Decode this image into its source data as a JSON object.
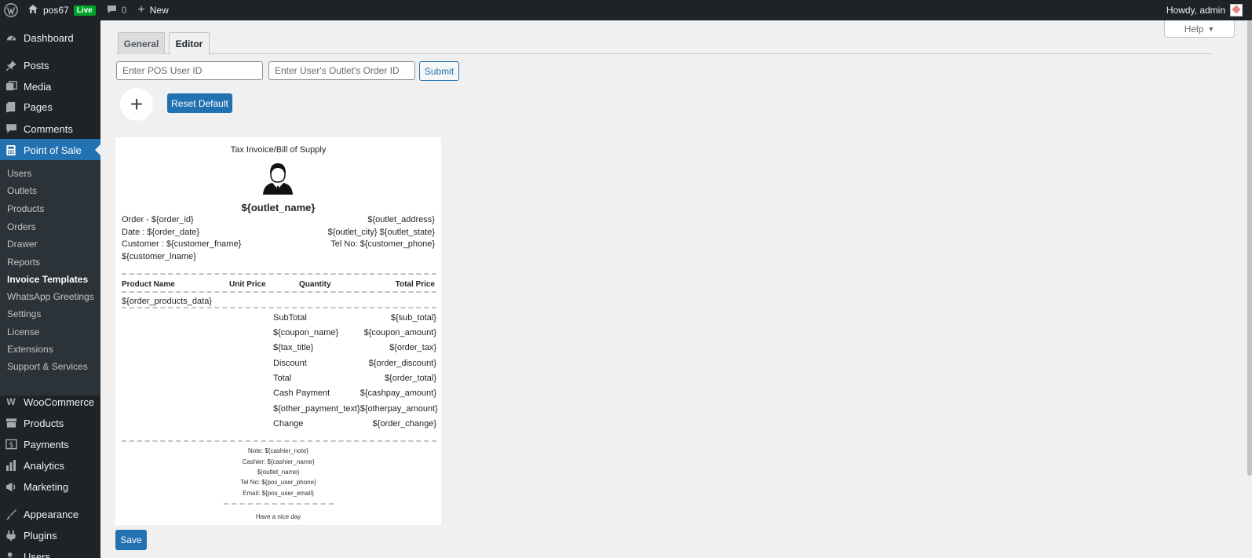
{
  "adminbar": {
    "site_name": "pos67",
    "live_badge": "Live",
    "comments_count": "0",
    "new_label": "New",
    "howdy": "Howdy, admin"
  },
  "sidebar": {
    "items": [
      {
        "label": "Dashboard",
        "icon": "dashboard-icon"
      },
      {
        "label": "Posts",
        "icon": "pin-icon"
      },
      {
        "label": "Media",
        "icon": "media-icon"
      },
      {
        "label": "Pages",
        "icon": "pages-icon"
      },
      {
        "label": "Comments",
        "icon": "comment-icon"
      },
      {
        "label": "Point of Sale",
        "icon": "calculator-icon"
      },
      {
        "label": "WooCommerce",
        "icon": "woo-icon"
      },
      {
        "label": "Products",
        "icon": "archive-icon"
      },
      {
        "label": "Payments",
        "icon": "dollar-icon"
      },
      {
        "label": "Analytics",
        "icon": "chart-icon"
      },
      {
        "label": "Marketing",
        "icon": "megaphone-icon"
      },
      {
        "label": "Appearance",
        "icon": "brush-icon"
      },
      {
        "label": "Plugins",
        "icon": "plugin-icon"
      },
      {
        "label": "Users",
        "icon": "users-icon"
      }
    ],
    "submenu": [
      "Users",
      "Outlets",
      "Products",
      "Orders",
      "Drawer",
      "Reports",
      "Invoice Templates",
      "WhatsApp Greetings",
      "Settings",
      "License",
      "Extensions",
      "Support & Services"
    ]
  },
  "help_label": "Help",
  "tabs": {
    "general": "General",
    "editor": "Editor"
  },
  "inputs": {
    "user_id_placeholder": "Enter POS User ID",
    "order_id_placeholder": "Enter User's Outlet's Order ID"
  },
  "buttons": {
    "submit": "Submit",
    "add": "+",
    "reset": "Reset Default",
    "save": "Save"
  },
  "invoice": {
    "title": "Tax Invoice/Bill of Supply",
    "outlet_name": "${outlet_name}",
    "left_lines": [
      "Order - ${order_id}",
      "Date : ${order_date}",
      "Customer : ${customer_fname}",
      "${customer_lname}"
    ],
    "right_lines": [
      "${outlet_address}",
      "${outlet_city} ${outlet_state}",
      "Tel No: ${customer_phone}"
    ],
    "headers": {
      "product": "Product Name",
      "unit_price": "Unit Price",
      "quantity": "Quantity",
      "total": "Total Price"
    },
    "products_data": "${order_products_data}",
    "totals": [
      {
        "label": "SubTotal",
        "value": "${sub_total}"
      },
      {
        "label": "${coupon_name}",
        "value": "${coupon_amount}"
      },
      {
        "label": "${tax_title}",
        "value": "${order_tax}"
      },
      {
        "label": "Discount",
        "value": "${order_discount}"
      },
      {
        "label": "Total",
        "value": "${order_total}"
      },
      {
        "label": "Cash Payment",
        "value": "${cashpay_amount}"
      },
      {
        "label": "${other_payment_text}",
        "value": "${otherpay_amount}"
      },
      {
        "label": "Change",
        "value": "${order_change}"
      }
    ],
    "footer": [
      "Note: ${cashier_note}",
      "Cashier: ${cashier_name}",
      "${outlet_name}",
      "Tel No: ${pos_user_phone}",
      "Email: ${pos_user_email}"
    ],
    "closing": "Have a nice day"
  }
}
